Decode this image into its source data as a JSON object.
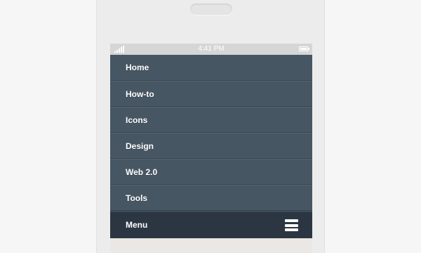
{
  "status_bar": {
    "time": "4:41 PM",
    "signal_icon": "signal-bars-icon",
    "battery_icon": "battery-icon"
  },
  "nav": {
    "items": [
      {
        "label": "Home"
      },
      {
        "label": "How-to"
      },
      {
        "label": "Icons"
      },
      {
        "label": "Design"
      },
      {
        "label": "Web 2.0"
      },
      {
        "label": "Tools"
      }
    ]
  },
  "menu_bar": {
    "label": "Menu",
    "icon": "hamburger-menu-icon"
  },
  "colors": {
    "nav_background": "#475663",
    "menu_bar_background": "#2b3642",
    "status_bar_background": "#d6d6d6",
    "text": "#ffffff"
  }
}
